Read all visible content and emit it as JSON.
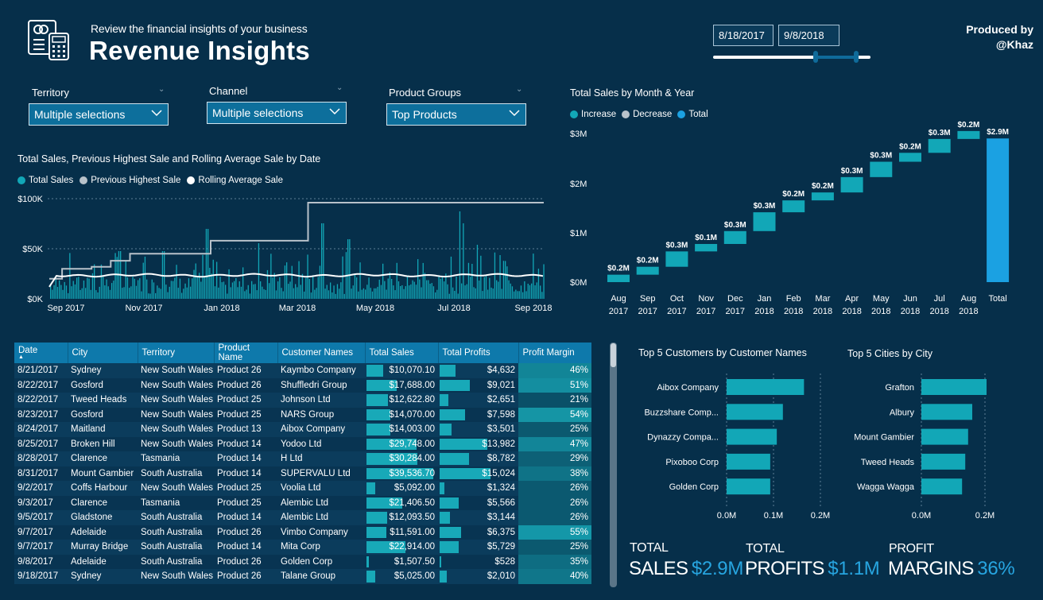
{
  "header": {
    "subtitle": "Review the financial insights of your business",
    "title": "Revenue Insights",
    "produced_line1": "Produced by",
    "produced_line2": "@Khaz",
    "date_start": "8/18/2017",
    "date_end": "9/8/2018",
    "slider_range": [
      0.65,
      0.91
    ]
  },
  "slicers": [
    {
      "label": "Territory",
      "value": "Multiple selections"
    },
    {
      "label": "Channel",
      "value": "Multiple selections"
    },
    {
      "label": "Product Groups",
      "value": "Top Products"
    }
  ],
  "colors": {
    "background": "#062f4a",
    "accent": "#12a7b7",
    "total": "#1ba1e2",
    "kpi_value": "#27a5e0",
    "header_row": "#0e79ab"
  },
  "line_chart": {
    "title": "Total Sales, Previous Highest Sale and Rolling Average Sale by Date",
    "legend": [
      "Total Sales",
      "Previous Highest Sale",
      "Rolling Average Sale"
    ],
    "y_ticks": [
      "$100K",
      "$50K",
      "$0K"
    ],
    "x_ticks": [
      "Sep 2017",
      "Nov 2017",
      "Jan 2018",
      "Mar 2018",
      "May 2018",
      "Jul 2018",
      "Sep 2018"
    ]
  },
  "chart_data": [
    {
      "type": "line",
      "title": "Total Sales, Previous Highest Sale and Rolling Average Sale by Date",
      "series": [
        {
          "name": "Previous Highest Sale",
          "x": [
            "2017-08-18",
            "2017-08-28",
            "2017-09-20",
            "2017-10-05",
            "2017-10-20",
            "2017-12-22",
            "2018-03-08",
            "2018-09-08"
          ],
          "values": [
            20000,
            30000,
            32000,
            38000,
            45000,
            58000,
            96000,
            96000
          ]
        },
        {
          "name": "Rolling Average Sale",
          "x": [
            "2017-08-18",
            "2017-09-01",
            "2017-10-01",
            "2017-12-01",
            "2018-02-01",
            "2018-05-01",
            "2018-09-08"
          ],
          "values": [
            15000,
            22000,
            24000,
            23000,
            24000,
            23500,
            23500
          ]
        }
      ],
      "ylim": [
        0,
        100000
      ]
    },
    {
      "type": "bar",
      "title": "Total Sales by Month & Year",
      "categories": [
        "Aug 2017",
        "Sep 2017",
        "Oct 2017",
        "Nov 2017",
        "Dec 2017",
        "Jan 2018",
        "Feb 2018",
        "Mar 2018",
        "Apr 2018",
        "May 2018",
        "Jun 2018",
        "Jul 2018",
        "Aug 2018",
        "Total"
      ],
      "values": [
        0.2,
        0.2,
        0.3,
        0.1,
        0.3,
        0.3,
        0.2,
        0.2,
        0.3,
        0.3,
        0.2,
        0.3,
        0.2,
        2.9
      ],
      "labels": [
        "$0.2M",
        "$0.2M",
        "$0.3M",
        "$0.1M",
        "$0.3M",
        "$0.3M",
        "$0.2M",
        "$0.2M",
        "$0.3M",
        "$0.3M",
        "$0.2M",
        "$0.3M",
        "$0.2M",
        "$2.9M"
      ],
      "legend": [
        "Increase",
        "Decrease",
        "Total"
      ],
      "y_ticks": [
        "$3M",
        "$2M",
        "$1M",
        "$0M"
      ],
      "ylim": [
        0,
        3
      ]
    },
    {
      "type": "bar",
      "title": "Top 5 Customers by Customer Names",
      "categories": [
        "Aibox Company",
        "Buzzshare Comp...",
        "Dynazzy Compa...",
        "Pixoboo Corp",
        "Golden Corp"
      ],
      "values": [
        0.165,
        0.12,
        0.107,
        0.093,
        0.093
      ],
      "x_ticks": [
        "0.0M",
        "0.1M",
        "0.2M"
      ],
      "xlim": [
        0,
        0.2
      ]
    },
    {
      "type": "bar",
      "title": "Top 5 Cities by City",
      "categories": [
        "Grafton",
        "Albury",
        "Mount Gambier",
        "Tweed Heads",
        "Wagga Wagga"
      ],
      "values": [
        0.205,
        0.16,
        0.147,
        0.138,
        0.128
      ],
      "x_ticks": [
        "0.0M",
        "0.2M"
      ],
      "xlim": [
        0,
        0.25
      ]
    }
  ],
  "table": {
    "columns": [
      "Date",
      "City",
      "Territory",
      "Product Name",
      "Customer Names",
      "Total Sales",
      "Total Profits",
      "Profit Margin"
    ],
    "rows": [
      {
        "date": "8/21/2017",
        "city": "Sydney",
        "territory": "New South Wales",
        "product": "Product 26",
        "customer": "Kaymbo Company",
        "sales": "$10,070.10",
        "sales_n": 10070,
        "profits": "$4,632",
        "profits_n": 4632,
        "margin": "46%",
        "margin_n": 46
      },
      {
        "date": "8/22/2017",
        "city": "Gosford",
        "territory": "New South Wales",
        "product": "Product 26",
        "customer": "Shuffledri Group",
        "sales": "$17,688.00",
        "sales_n": 17688,
        "profits": "$9,021",
        "profits_n": 9021,
        "margin": "51%",
        "margin_n": 51
      },
      {
        "date": "8/22/2017",
        "city": "Tweed Heads",
        "territory": "New South Wales",
        "product": "Product 25",
        "customer": "Johnson Ltd",
        "sales": "$12,622.80",
        "sales_n": 12623,
        "profits": "$2,651",
        "profits_n": 2651,
        "margin": "21%",
        "margin_n": 21
      },
      {
        "date": "8/23/2017",
        "city": "Gosford",
        "territory": "New South Wales",
        "product": "Product 25",
        "customer": "NARS Group",
        "sales": "$14,070.00",
        "sales_n": 14070,
        "profits": "$7,598",
        "profits_n": 7598,
        "margin": "54%",
        "margin_n": 54
      },
      {
        "date": "8/24/2017",
        "city": "Maitland",
        "territory": "New South Wales",
        "product": "Product 13",
        "customer": "Aibox Company",
        "sales": "$14,003.00",
        "sales_n": 14003,
        "profits": "$3,501",
        "profits_n": 3501,
        "margin": "25%",
        "margin_n": 25
      },
      {
        "date": "8/25/2017",
        "city": "Broken Hill",
        "territory": "New South Wales",
        "product": "Product 14",
        "customer": "Yodoo Ltd",
        "sales": "$29,748.00",
        "sales_n": 29748,
        "profits": "$13,982",
        "profits_n": 13982,
        "margin": "47%",
        "margin_n": 47
      },
      {
        "date": "8/28/2017",
        "city": "Clarence",
        "territory": "Tasmania",
        "product": "Product 14",
        "customer": "H Ltd",
        "sales": "$30,284.00",
        "sales_n": 30284,
        "profits": "$8,782",
        "profits_n": 8782,
        "margin": "29%",
        "margin_n": 29
      },
      {
        "date": "8/31/2017",
        "city": "Mount Gambier",
        "territory": "South Australia",
        "product": "Product 14",
        "customer": "SUPERVALU Ltd",
        "sales": "$39,536.70",
        "sales_n": 39537,
        "profits": "$15,024",
        "profits_n": 15024,
        "margin": "38%",
        "margin_n": 38
      },
      {
        "date": "9/2/2017",
        "city": "Coffs Harbour",
        "territory": "New South Wales",
        "product": "Product 25",
        "customer": "Voolia Ltd",
        "sales": "$5,092.00",
        "sales_n": 5092,
        "profits": "$1,324",
        "profits_n": 1324,
        "margin": "26%",
        "margin_n": 26
      },
      {
        "date": "9/3/2017",
        "city": "Clarence",
        "territory": "Tasmania",
        "product": "Product 25",
        "customer": "Alembic Ltd",
        "sales": "$21,406.50",
        "sales_n": 21407,
        "profits": "$5,566",
        "profits_n": 5566,
        "margin": "26%",
        "margin_n": 26
      },
      {
        "date": "9/5/2017",
        "city": "Gladstone",
        "territory": "South Australia",
        "product": "Product 14",
        "customer": "Alembic Ltd",
        "sales": "$12,093.50",
        "sales_n": 12094,
        "profits": "$3,144",
        "profits_n": 3144,
        "margin": "26%",
        "margin_n": 26
      },
      {
        "date": "9/7/2017",
        "city": "Adelaide",
        "territory": "South Australia",
        "product": "Product 26",
        "customer": "Vimbo Company",
        "sales": "$11,591.00",
        "sales_n": 11591,
        "profits": "$6,375",
        "profits_n": 6375,
        "margin": "55%",
        "margin_n": 55
      },
      {
        "date": "9/7/2017",
        "city": "Murray Bridge",
        "territory": "South Australia",
        "product": "Product 14",
        "customer": "Mita Corp",
        "sales": "$22,914.00",
        "sales_n": 22914,
        "profits": "$5,729",
        "profits_n": 5729,
        "margin": "25%",
        "margin_n": 25
      },
      {
        "date": "9/8/2017",
        "city": "Adelaide",
        "territory": "South Australia",
        "product": "Product 26",
        "customer": "Golden Corp",
        "sales": "$1,507.50",
        "sales_n": 1508,
        "profits": "$528",
        "profits_n": 528,
        "margin": "35%",
        "margin_n": 35
      },
      {
        "date": "9/18/2017",
        "city": "Sydney",
        "territory": "New South Wales",
        "product": "Product 26",
        "customer": "Talane Group",
        "sales": "$5,025.00",
        "sales_n": 5025,
        "profits": "$2,010",
        "profits_n": 2010,
        "margin": "40%",
        "margin_n": 40
      }
    ]
  },
  "kpis": [
    {
      "top": "TOTAL",
      "label": "SALES",
      "value": "$2.9M"
    },
    {
      "top": "TOTAL",
      "label": "PROFITS",
      "value": "$1.1M"
    },
    {
      "top": "PROFIT",
      "label": "MARGINS",
      "value": "36%"
    }
  ]
}
